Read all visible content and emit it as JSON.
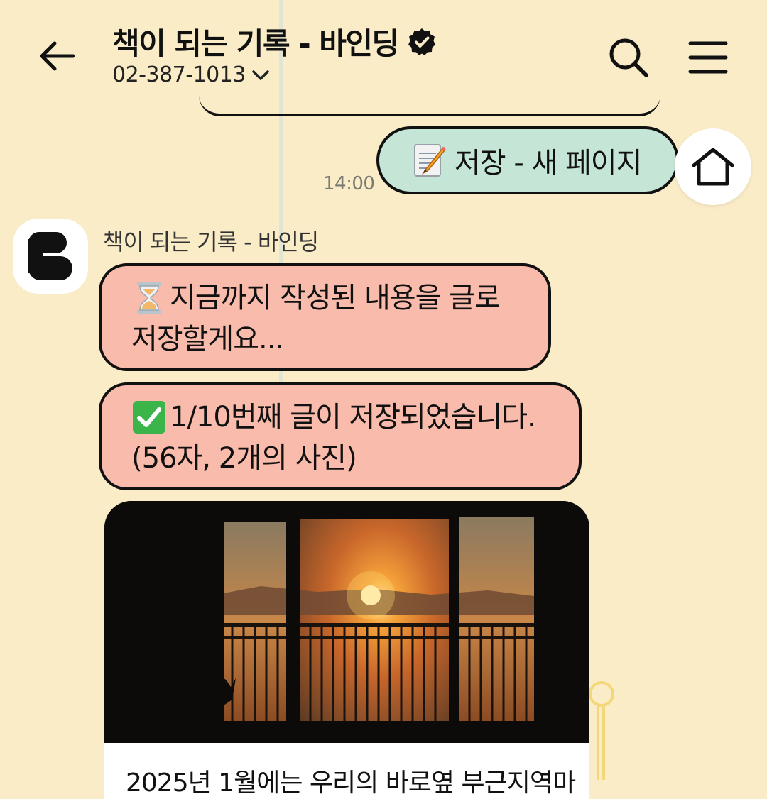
{
  "header": {
    "back_icon": "arrow-left-icon",
    "title": "책이 되는 기록 - 바인딩",
    "verified_icon": "verified-badge-icon",
    "phone": "02-387-1013",
    "search_icon": "search-icon",
    "menu_icon": "hamburger-menu-icon"
  },
  "chat": {
    "my_message": {
      "icon": "memo-icon",
      "text": "저장 - 새 페이지",
      "time": "14:00"
    },
    "home_icon": "home-icon",
    "bot": {
      "sender": "책이 되는 기록 - 바인딩",
      "messages": [
        {
          "icon": "hourglass-icon",
          "line1": "지금까지 작성된 내용을 글로",
          "line2": "저장할게요..."
        },
        {
          "icon": "check-mark-button-icon",
          "line1": "1/10번째 글이 저장되었습니다.",
          "line2": "(56자, 2개의 사진)"
        }
      ],
      "card_caption": "2025년 1월에는 우리의 바로옆 부근지역마"
    }
  },
  "colors": {
    "background": "#fbecc8",
    "my_bubble": "#c5e6d6",
    "bot_bubble": "#f9bbab",
    "border": "#111111"
  }
}
